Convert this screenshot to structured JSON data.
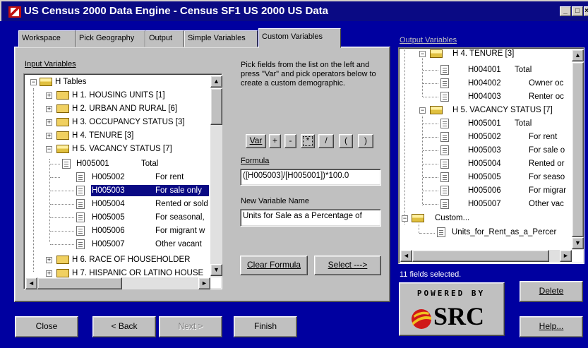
{
  "window": {
    "title": "US Census 2000 Data Engine - Census SF1 US 2000 US Data",
    "min_label": "_",
    "max_label": "□",
    "close_label": "×"
  },
  "tabs": [
    {
      "label": "Workspace"
    },
    {
      "label": "Pick Geography"
    },
    {
      "label": "Output"
    },
    {
      "label": "Simple Variables"
    },
    {
      "label": "Custom Variables"
    }
  ],
  "input_variables": {
    "label": "Input Variables",
    "root": "H Tables",
    "groups": [
      "H 1. HOUSING UNITS [1]",
      "H 2. URBAN AND RURAL [6]",
      "H 3. OCCUPANCY STATUS [3]",
      "H 4. TENURE [3]",
      "H 5. VACANCY STATUS [7]"
    ],
    "items": [
      {
        "code": "H005001",
        "desc": "Total"
      },
      {
        "code": "H005002",
        "desc": "For rent"
      },
      {
        "code": "H005003",
        "desc": "For sale only"
      },
      {
        "code": "H005004",
        "desc": "Rented or sold"
      },
      {
        "code": "H005005",
        "desc": "For seasonal,"
      },
      {
        "code": "H005006",
        "desc": "For migrant w"
      },
      {
        "code": "H005007",
        "desc": "Other vacant"
      }
    ],
    "after_groups": [
      "H 6. RACE OF HOUSEHOLDER",
      "H 7. HISPANIC OR LATINO HOUSE"
    ]
  },
  "instructions": "Pick fields from the list on the left and press \"Var\" and pick operators below to create a custom demographic.",
  "operators": [
    "Var",
    "+",
    "-",
    "*",
    "/",
    "(",
    ")"
  ],
  "formula": {
    "label": "Formula",
    "value": "([H005003]/[H005001])*100.0"
  },
  "new_variable": {
    "label": "New Variable Name",
    "value": "Units for Sale as a Percentage of"
  },
  "buttons": {
    "clear_formula": "Clear Formula",
    "select": "Select --->",
    "close": "Close",
    "back": "< Back",
    "next": "Next >",
    "finish": "Finish",
    "delete": "Delete",
    "help": "Help..."
  },
  "output_variables": {
    "label": "Output Variables",
    "group1": "H 4. TENURE [3]",
    "group1_items": [
      {
        "code": "H004001",
        "desc": "Total"
      },
      {
        "code": "H004002",
        "desc": "Owner oc"
      },
      {
        "code": "H004003",
        "desc": "Renter oc"
      }
    ],
    "group2": "H 5. VACANCY STATUS [7]",
    "group2_items": [
      {
        "code": "H005001",
        "desc": "Total"
      },
      {
        "code": "H005002",
        "desc": "For rent"
      },
      {
        "code": "H005003",
        "desc": "For sale o"
      },
      {
        "code": "H005004",
        "desc": "Rented or"
      },
      {
        "code": "H005005",
        "desc": "For seaso"
      },
      {
        "code": "H005006",
        "desc": "For migrar"
      },
      {
        "code": "H005007",
        "desc": "Other vac"
      }
    ],
    "custom": "Custom...",
    "custom_item": "Units_for_Rent_as_a_Percer"
  },
  "status": "11 fields selected.",
  "logo": {
    "powered_by": "POWERED BY",
    "brand": "SRC"
  }
}
